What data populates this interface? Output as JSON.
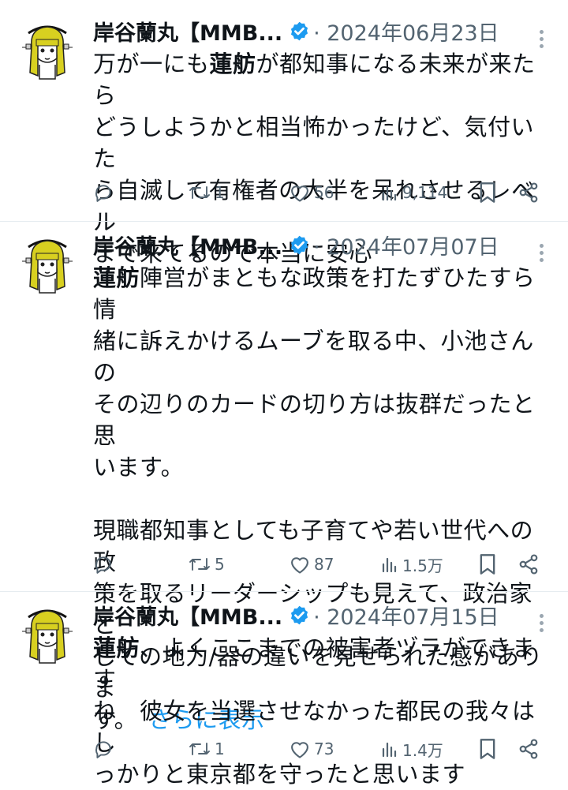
{
  "tweets": [
    {
      "name": "岸谷蘭丸【MMB...",
      "meta": "· 2024年06月23日",
      "body_lines": [
        [
          {
            "t": "万が一にも"
          },
          {
            "t": "蓮舫",
            "b": true
          },
          {
            "t": "が都知事になる未来が来たら"
          }
        ],
        [
          {
            "t": "どうしようかと相当怖かったけど、気付いた"
          }
        ],
        [
          {
            "t": "ら自滅して有権者の大半を呆れさせるレベル"
          }
        ],
        [
          {
            "t": "まで来てるので本当に安心"
          }
        ]
      ],
      "show_more": "",
      "reply": "",
      "retweets": "1",
      "likes": "56",
      "views": "9,114"
    },
    {
      "name": "岸谷蘭丸【MMB...",
      "meta": "· 2024年07月07日",
      "body_lines": [
        [
          {
            "t": "蓮舫",
            "b": true
          },
          {
            "t": "陣営がまともな政策を打たずひたすら情"
          }
        ],
        [
          {
            "t": "緒に訴えかけるムーブを取る中、小池さんの"
          }
        ],
        [
          {
            "t": "その辺りのカードの切り方は抜群だったと思"
          }
        ],
        [
          {
            "t": "います。"
          }
        ],
        [],
        [
          {
            "t": "現職都知事としても子育てや若い世代への政"
          }
        ],
        [
          {
            "t": "策を取るリーダーシップも見えて、政治家と"
          }
        ],
        [
          {
            "t": "しての地力/器の違いを見せられた感がありま"
          }
        ],
        [
          {
            "t": "す。"
          }
        ]
      ],
      "show_more": "さらに表示",
      "reply": "",
      "retweets": "5",
      "likes": "87",
      "views": "1.5万"
    },
    {
      "name": "岸谷蘭丸【MMB...",
      "meta": "· 2024年07月15日",
      "body_lines": [
        [
          {
            "t": "蓮舫",
            "b": true
          },
          {
            "t": "、よくここまでの被害者ヅラができます"
          }
        ],
        [
          {
            "t": "ね　彼女を当選させなかった都民の我々はし"
          }
        ],
        [
          {
            "t": "っかりと東京都を守ったと思います"
          }
        ]
      ],
      "show_more": "",
      "reply": "",
      "retweets": "1",
      "likes": "73",
      "views": "1.4万"
    }
  ],
  "colors": {
    "accent": "#1d9bf0",
    "secondary_text": "#536471",
    "verified": "#1d9bf0",
    "avatar_hair": "#d8d020"
  },
  "icons": [
    "reply-icon",
    "retweet-icon",
    "like-icon",
    "views-icon",
    "bookmark-icon",
    "share-icon",
    "verified-icon",
    "more-icon"
  ]
}
